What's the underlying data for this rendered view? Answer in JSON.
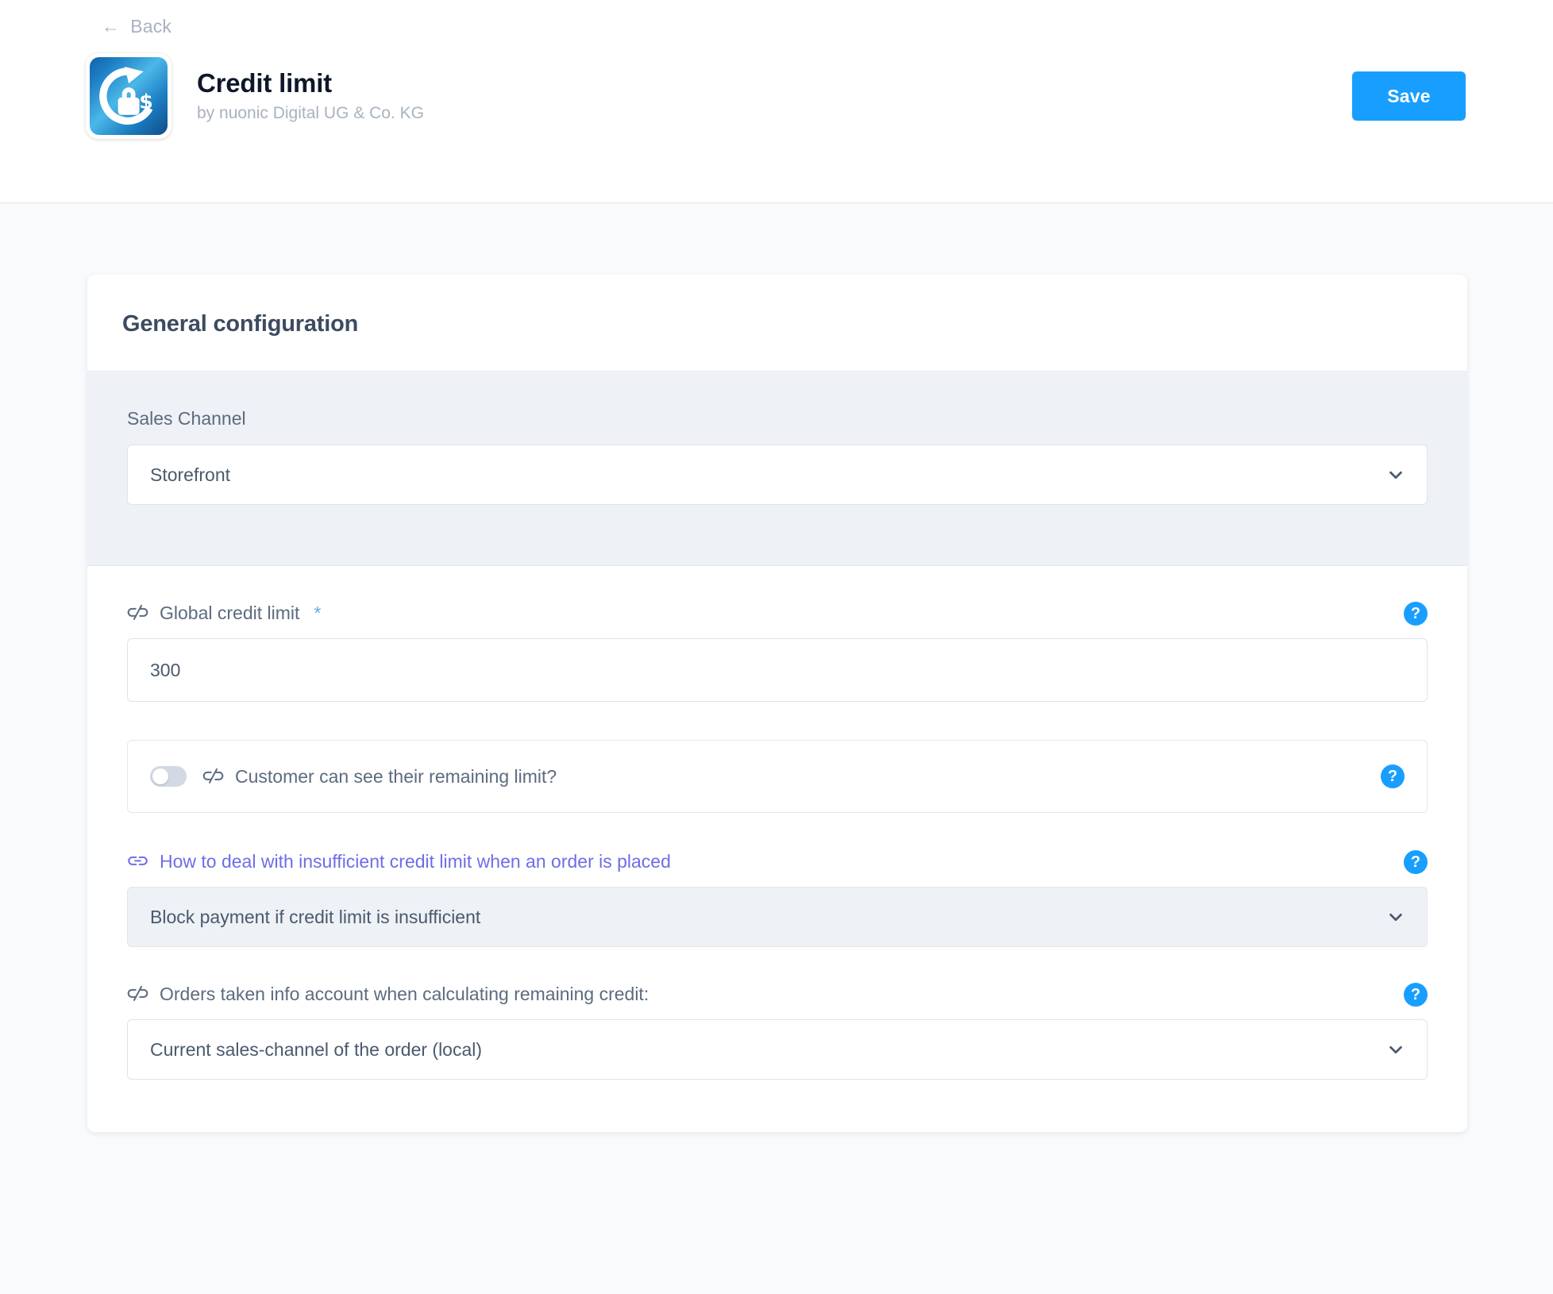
{
  "header": {
    "back_label": "Back",
    "back_icon": "arrow-left-icon",
    "app_icon": "credit-limit-app-icon",
    "app_title": "Credit limit",
    "app_author": "by nuonic Digital UG & Co. KG",
    "save_label": "Save",
    "accent_color": "#189eff"
  },
  "card": {
    "title": "General configuration",
    "sales_channel": {
      "label": "Sales Channel",
      "value": "Storefront",
      "chevron_icon": "chevron-down-icon"
    },
    "global_credit_limit": {
      "icon": "broken-link-icon",
      "label": "Global credit limit",
      "required_marker": "*",
      "help_icon": "question-mark-icon",
      "value": "300",
      "placeholder": ""
    },
    "customer_sees_limit": {
      "icon": "broken-link-icon",
      "label": "Customer can see their remaining limit?",
      "toggle_state": "off",
      "help_icon": "question-mark-icon"
    },
    "insufficient_limit": {
      "icon": "linked-chain-icon",
      "label": "How to deal with insufficient credit limit when an order is placed",
      "label_color": "#6e6de8",
      "help_icon": "question-mark-icon",
      "value": "Block payment if credit limit is insufficient",
      "chevron_icon": "chevron-down-icon",
      "state": "inherited"
    },
    "orders_taken_into_account": {
      "icon": "broken-link-icon",
      "label": "Orders taken info account when calculating remaining credit:",
      "help_icon": "question-mark-icon",
      "value": "Current sales-channel of the order (local)",
      "chevron_icon": "chevron-down-icon"
    }
  }
}
